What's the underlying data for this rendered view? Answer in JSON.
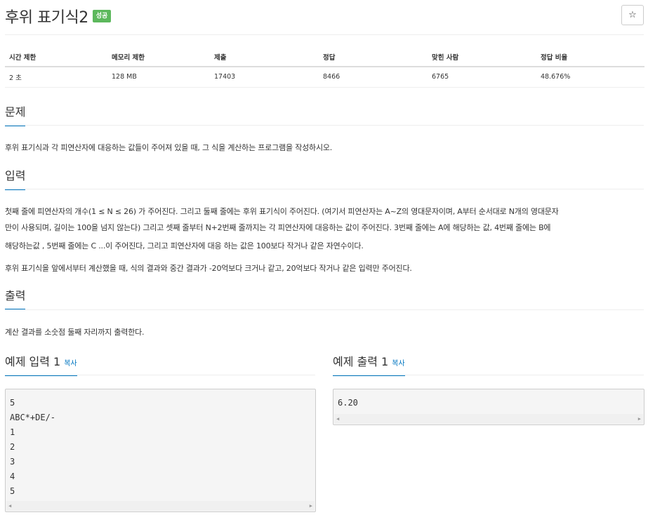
{
  "problem": {
    "title": "후위 표기식2",
    "status_badge": "성공",
    "star_icon": "☆"
  },
  "info_table": {
    "headers": [
      "시간 제한",
      "메모리 제한",
      "제출",
      "정답",
      "맞힌 사람",
      "정답 비율"
    ],
    "values": [
      "2 초",
      "128 MB",
      "17403",
      "8466",
      "6765",
      "48.676%"
    ]
  },
  "sections": {
    "problem_title": "문제",
    "problem_text": "후위 표기식과 각 피연산자에 대응하는 값들이 주어져 있을 때, 그 식을 계산하는 프로그램을 작성하시오.",
    "input_title": "입력",
    "input_line1": "첫째 줄에 피연산자의 개수(1 ≤ N ≤ 26) 가 주어진다. 그리고 둘째 줄에는 후위 표기식이 주어진다. (여기서 피연산자는 A~Z의 영대문자이며, A부터 순서대로 N개의 영대문자",
    "input_line2": "만이 사용되며, 길이는 100을 넘지 않는다) 그리고 셋째 줄부터 N+2번째 줄까지는 각 피연산자에 대응하는 값이 주어진다. 3번째 줄에는 A에 해당하는 값, 4번째 줄에는 B에",
    "input_line3": "해당하는값 , 5번째 줄에는 C ...이 주어진다, 그리고 피연산자에 대응 하는 값은 100보다 작거나 같은 자연수이다.",
    "input_text2": "후위 표기식을 앞에서부터 계산했을 때, 식의 결과와 중간 결과가 -20억보다 크거나 같고, 20억보다 작거나 같은 입력만 주어진다.",
    "output_title": "출력",
    "output_text": "계산 결과를 소숫점 둘째 자리까지 출력한다."
  },
  "examples": {
    "input_title": "예제 입력 1",
    "output_title": "예제 출력 1",
    "copy_label": "복사",
    "input_lines": [
      "5",
      "ABC*+DE/-",
      "1",
      "2",
      "3",
      "4",
      "5"
    ],
    "output_lines": [
      "6.20"
    ]
  },
  "colors": {
    "accent": "#0076c0",
    "success": "#5cb85c"
  }
}
